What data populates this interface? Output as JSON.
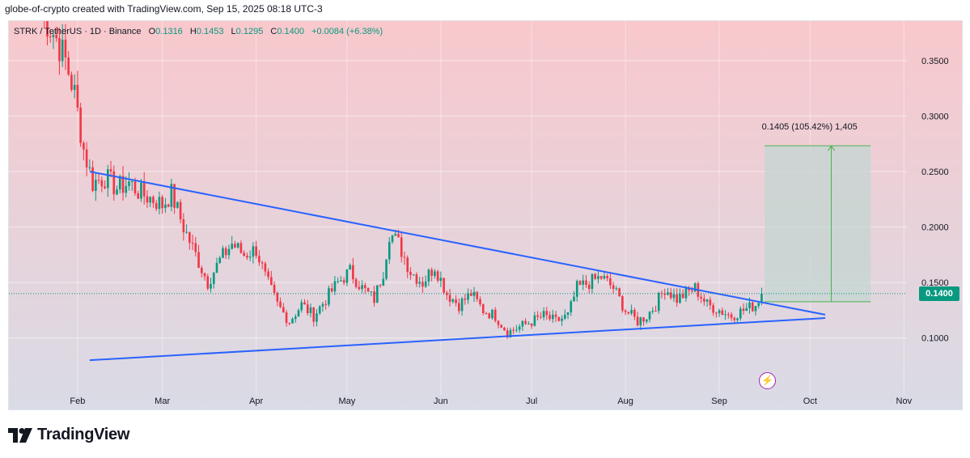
{
  "header": {
    "credit": "globe-of-crypto created with TradingView.com, Sep 15, 2025 08:18 UTC-3"
  },
  "legend": {
    "symbol": "STRK / TetherUS · 1D · Binance",
    "o_label": "O",
    "o_value": "0.1316",
    "h_label": "H",
    "h_value": "0.1453",
    "l_label": "L",
    "l_value": "0.1295",
    "c_label": "C",
    "c_value": "0.1400",
    "change": "+0.0084 (+6.38%)"
  },
  "measure_label": "0.1405 (105.42%) 1,405",
  "current_price_label": "0.1400",
  "branding": {
    "name": "TradingView",
    "icon": "tradingview-logo-icon"
  },
  "colors": {
    "up": "#089981",
    "down": "#f23645",
    "trendline": "#2962ff",
    "bg_top": "#f8c8cc",
    "bg_bottom": "#d9dbe6",
    "measure_fill": "#c3d6d2",
    "measure_line": "#4caf50"
  },
  "chart_data": {
    "type": "candlestick",
    "title": "STRK / TetherUS · 1D · Binance",
    "x_axis": {
      "tick_labels": [
        "Feb",
        "Mar",
        "Apr",
        "May",
        "Jun",
        "Jul",
        "Aug",
        "Sep",
        "Oct",
        "Nov"
      ],
      "range": [
        "2025-01-20",
        "2025-11-10"
      ]
    },
    "y_axis": {
      "tick_labels": [
        "0.1000",
        "0.1500",
        "0.2000",
        "0.2500",
        "0.3000",
        "0.3500"
      ],
      "range": [
        0.04,
        0.39
      ],
      "position": "right",
      "grid": true
    },
    "price_path": [
      [
        "2025-01-20",
        0.395
      ],
      [
        "2025-01-25",
        0.37
      ],
      [
        "2025-01-28",
        0.35
      ],
      [
        "2025-01-31",
        0.32
      ],
      [
        "2025-02-03",
        0.27
      ],
      [
        "2025-02-06",
        0.24
      ],
      [
        "2025-02-10",
        0.245
      ],
      [
        "2025-02-14",
        0.235
      ],
      [
        "2025-02-18",
        0.24
      ],
      [
        "2025-02-22",
        0.23
      ],
      [
        "2025-02-26",
        0.225
      ],
      [
        "2025-03-01",
        0.22
      ],
      [
        "2025-03-04",
        0.23
      ],
      [
        "2025-03-08",
        0.2
      ],
      [
        "2025-03-12",
        0.175
      ],
      [
        "2025-03-16",
        0.15
      ],
      [
        "2025-03-20",
        0.17
      ],
      [
        "2025-03-24",
        0.185
      ],
      [
        "2025-03-28",
        0.175
      ],
      [
        "2025-04-01",
        0.18
      ],
      [
        "2025-04-04",
        0.155
      ],
      [
        "2025-04-08",
        0.13
      ],
      [
        "2025-04-12",
        0.115
      ],
      [
        "2025-04-16",
        0.13
      ],
      [
        "2025-04-20",
        0.12
      ],
      [
        "2025-04-24",
        0.135
      ],
      [
        "2025-04-28",
        0.15
      ],
      [
        "2025-05-02",
        0.16
      ],
      [
        "2025-05-06",
        0.145
      ],
      [
        "2025-05-10",
        0.135
      ],
      [
        "2025-05-13",
        0.16
      ],
      [
        "2025-05-15",
        0.195
      ],
      [
        "2025-05-18",
        0.185
      ],
      [
        "2025-05-22",
        0.16
      ],
      [
        "2025-05-26",
        0.15
      ],
      [
        "2025-05-30",
        0.165
      ],
      [
        "2025-06-03",
        0.14
      ],
      [
        "2025-06-07",
        0.13
      ],
      [
        "2025-06-11",
        0.14
      ],
      [
        "2025-06-15",
        0.125
      ],
      [
        "2025-06-19",
        0.12
      ],
      [
        "2025-06-23",
        0.105
      ],
      [
        "2025-06-27",
        0.11
      ],
      [
        "2025-07-01",
        0.115
      ],
      [
        "2025-07-05",
        0.12
      ],
      [
        "2025-07-09",
        0.115
      ],
      [
        "2025-07-13",
        0.12
      ],
      [
        "2025-07-16",
        0.145
      ],
      [
        "2025-07-20",
        0.15
      ],
      [
        "2025-07-24",
        0.155
      ],
      [
        "2025-07-28",
        0.145
      ],
      [
        "2025-08-01",
        0.125
      ],
      [
        "2025-08-05",
        0.115
      ],
      [
        "2025-08-08",
        0.12
      ],
      [
        "2025-08-11",
        0.13
      ],
      [
        "2025-08-14",
        0.145
      ],
      [
        "2025-08-18",
        0.135
      ],
      [
        "2025-08-21",
        0.14
      ],
      [
        "2025-08-24",
        0.145
      ],
      [
        "2025-08-28",
        0.13
      ],
      [
        "2025-09-01",
        0.125
      ],
      [
        "2025-09-05",
        0.12
      ],
      [
        "2025-09-09",
        0.125
      ],
      [
        "2025-09-13",
        0.13
      ],
      [
        "2025-09-15",
        0.14
      ]
    ],
    "last_candle": {
      "date": "2025-09-15",
      "open": 0.1316,
      "high": 0.1453,
      "low": 0.1295,
      "close": 0.14
    },
    "trendlines": [
      {
        "name": "descending resistance",
        "from": [
          "2025-02-05",
          0.25
        ],
        "to": [
          "2025-10-06",
          0.121
        ]
      },
      {
        "name": "ascending support",
        "from": [
          "2025-02-05",
          0.08
        ],
        "to": [
          "2025-10-06",
          0.118
        ]
      }
    ],
    "projection": {
      "from_date": "2025-09-16",
      "to_date": "2025-10-21",
      "base_price": 0.1327,
      "target_price": 0.2732,
      "arrow_date": "2025-10-08",
      "label": "0.1405 (105.42%) 1,405"
    },
    "current_price": 0.14
  }
}
